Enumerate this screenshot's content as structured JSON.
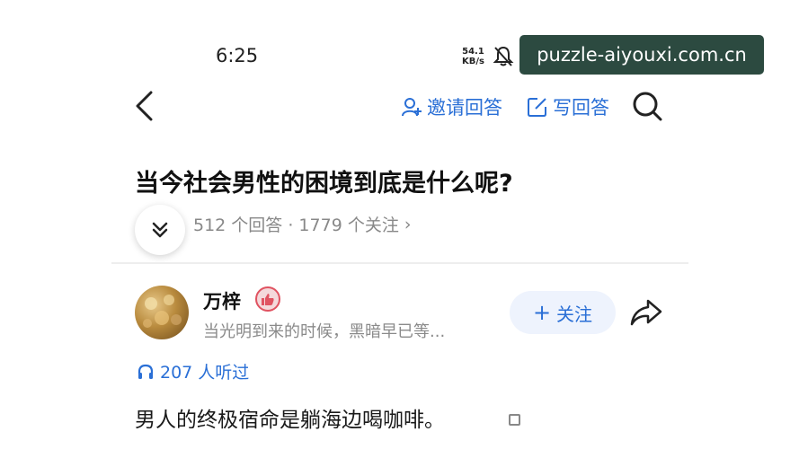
{
  "status_bar": {
    "time": "6:25",
    "net_speed_value": "54.1",
    "net_speed_unit": "KB/s",
    "icons": [
      "bell-mute-icon"
    ]
  },
  "watermark": {
    "text": "puzzle-aiyouxi.com.cn"
  },
  "nav": {
    "back_icon": "chevron-left-icon",
    "invite_label": "邀请回答",
    "write_label": "写回答",
    "search_icon": "search-icon"
  },
  "question": {
    "title": "当今社会男性的困境到底是什么呢?",
    "stats": "512 个回答 · 1779 个关注",
    "stats_chevron": "›"
  },
  "answer": {
    "author_name": "万梓",
    "author_bio": "当光明到来的时候，黑暗早已等...",
    "follow_label": "关注",
    "follow_plus": "+",
    "listen_count": "207 人听过",
    "text": "男人的终极宿命是躺海边喝咖啡。"
  },
  "colors": {
    "accent": "#2a6fd6",
    "follow_bg": "#eef3fd",
    "watermark_bg": "#2c4a40"
  }
}
